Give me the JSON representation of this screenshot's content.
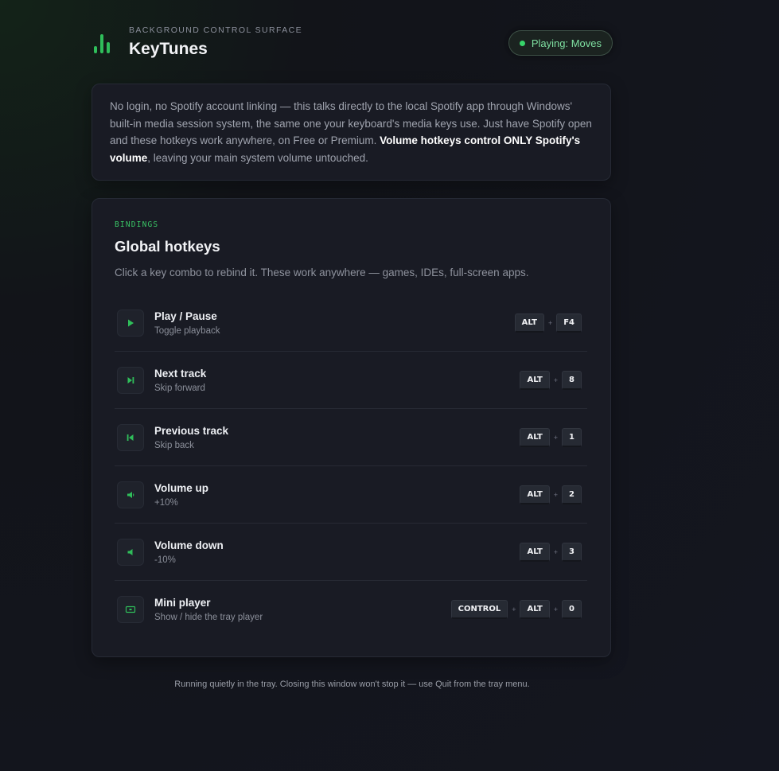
{
  "header": {
    "eyebrow": "BACKGROUND CONTROL SURFACE",
    "title": "KeyTunes",
    "status": "Playing: Moves"
  },
  "info": {
    "text_before": "No login, no Spotify account linking — this talks directly to the local Spotify app through Windows' built-in media session system, the same one your keyboard's media keys use. Just have Spotify open and these hotkeys work anywhere, on Free or Premium. ",
    "text_bold": "Volume hotkeys control ONLY Spotify's volume",
    "text_after": ", leaving your main system volume untouched."
  },
  "bindings": {
    "tag": "BINDINGS",
    "title": "Global hotkeys",
    "description": "Click a key combo to rebind it. These work anywhere — games, IDEs, full-screen apps.",
    "separator": "+",
    "rows": [
      {
        "icon": "play-icon",
        "label": "Play / Pause",
        "sub": "Toggle playback",
        "keys": [
          "ALT",
          "F4"
        ]
      },
      {
        "icon": "skip-forward-icon",
        "label": "Next track",
        "sub": "Skip forward",
        "keys": [
          "ALT",
          "8"
        ]
      },
      {
        "icon": "skip-back-icon",
        "label": "Previous track",
        "sub": "Skip back",
        "keys": [
          "ALT",
          "1"
        ]
      },
      {
        "icon": "volume-up-icon",
        "label": "Volume up",
        "sub": "+10%",
        "keys": [
          "ALT",
          "2"
        ]
      },
      {
        "icon": "volume-down-icon",
        "label": "Volume down",
        "sub": "-10%",
        "keys": [
          "ALT",
          "3"
        ]
      },
      {
        "icon": "mini-player-icon",
        "label": "Mini player",
        "sub": "Show / hide the tray player",
        "keys": [
          "CONTROL",
          "ALT",
          "0"
        ]
      }
    ]
  },
  "footer": "Running quietly in the tray. Closing this window won't stop it — use Quit from the tray menu.",
  "colors": {
    "accent": "#39c465",
    "status_text": "#7fe0a1",
    "background": "#141620",
    "card": "#191b24"
  }
}
